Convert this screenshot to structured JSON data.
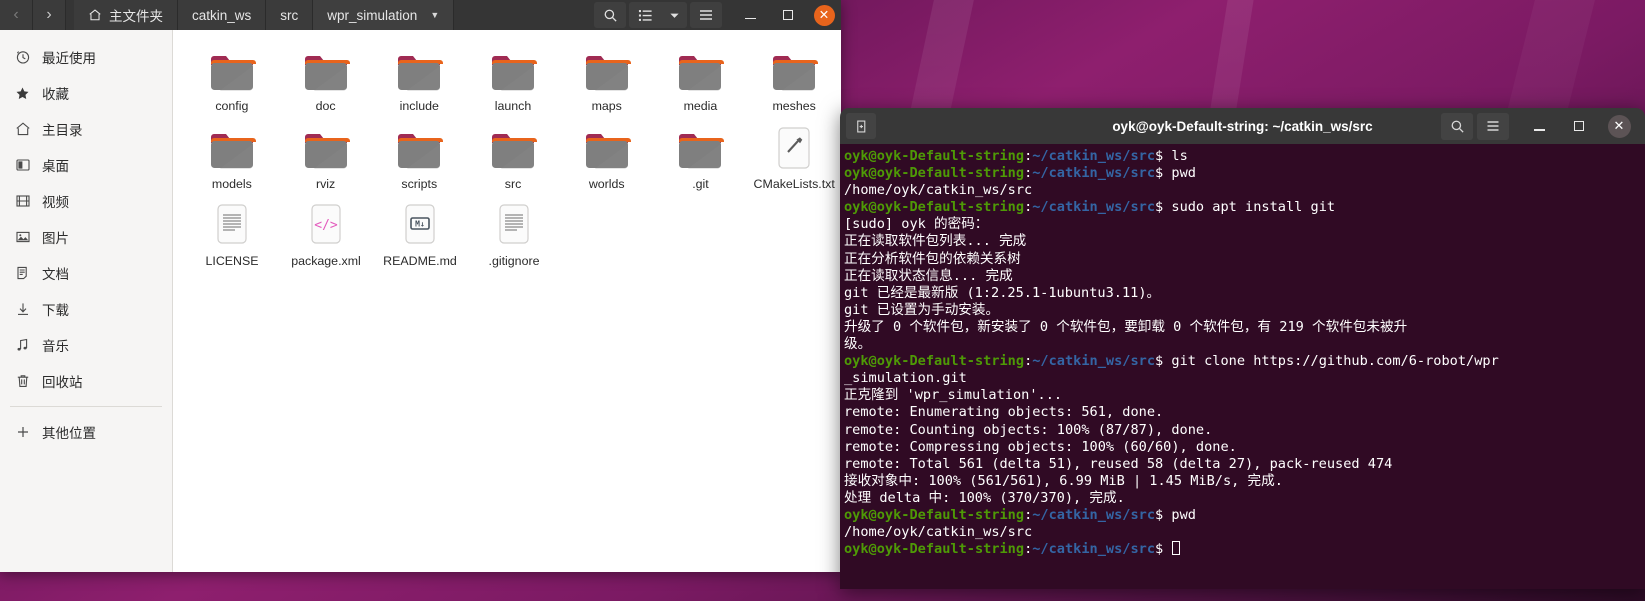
{
  "file_manager": {
    "nav": {
      "back": "‹",
      "forward": "›"
    },
    "breadcrumbs": [
      {
        "label": "主文件夹",
        "icon": "home-icon",
        "active": false
      },
      {
        "label": "catkin_ws",
        "icon": "",
        "active": false
      },
      {
        "label": "src",
        "icon": "",
        "active": false
      },
      {
        "label": "wpr_simulation",
        "icon": "",
        "active": true
      }
    ],
    "toolbar": {
      "search": "search-icon",
      "view_list": "list-view-icon",
      "view_dropdown": "chevron-down-icon",
      "menu": "hamburger-menu-icon"
    },
    "window_controls": {
      "minimize": "–",
      "maximize": "□",
      "close": "✕"
    },
    "sidebar": [
      {
        "label": "最近使用",
        "icon": "clock-icon"
      },
      {
        "label": "收藏",
        "icon": "star-icon"
      },
      {
        "label": "主目录",
        "icon": "home-icon"
      },
      {
        "label": "桌面",
        "icon": "desktop-icon"
      },
      {
        "label": "视频",
        "icon": "video-icon"
      },
      {
        "label": "图片",
        "icon": "image-icon"
      },
      {
        "label": "文档",
        "icon": "document-icon"
      },
      {
        "label": "下载",
        "icon": "download-icon"
      },
      {
        "label": "音乐",
        "icon": "music-icon"
      },
      {
        "label": "回收站",
        "icon": "trash-icon"
      },
      {
        "label": "其他位置",
        "icon": "plus-icon",
        "separated": true
      }
    ],
    "files": [
      [
        {
          "name": "config",
          "type": "folder"
        },
        {
          "name": "doc",
          "type": "folder"
        },
        {
          "name": "include",
          "type": "folder"
        },
        {
          "name": "launch",
          "type": "folder"
        },
        {
          "name": "maps",
          "type": "folder"
        },
        {
          "name": "media",
          "type": "folder"
        },
        {
          "name": "meshes",
          "type": "folder"
        }
      ],
      [
        {
          "name": "models",
          "type": "folder"
        },
        {
          "name": "rviz",
          "type": "folder"
        },
        {
          "name": "scripts",
          "type": "folder"
        },
        {
          "name": "src",
          "type": "folder"
        },
        {
          "name": "worlds",
          "type": "folder"
        },
        {
          "name": ".git",
          "type": "folder"
        },
        {
          "name": "CMakeLists.txt",
          "type": "build-file"
        }
      ],
      [
        {
          "name": "LICENSE",
          "type": "text-file"
        },
        {
          "name": "package.xml",
          "type": "code-file"
        },
        {
          "name": "README.md",
          "type": "markdown-file"
        },
        {
          "name": ".gitignore",
          "type": "text-file"
        }
      ]
    ]
  },
  "terminal": {
    "title": "oyk@oyk-Default-string: ~/catkin_ws/src",
    "new_tab_icon": "new-tab-icon",
    "search_icon": "search-icon",
    "menu_icon": "hamburger-menu-icon",
    "window_controls": {
      "minimize": "–",
      "maximize": "□",
      "close": "✕"
    },
    "prompt_user": "oyk@oyk-Default-string",
    "prompt_path": "~/catkin_ws/src",
    "lines": [
      {
        "type": "prompt",
        "command": " ls"
      },
      {
        "type": "prompt",
        "command": " pwd"
      },
      {
        "type": "out",
        "text": "/home/oyk/catkin_ws/src"
      },
      {
        "type": "prompt",
        "command": " sudo apt install git"
      },
      {
        "type": "out",
        "text": "[sudo] oyk 的密码："
      },
      {
        "type": "out",
        "text": "正在读取软件包列表... 完成"
      },
      {
        "type": "out",
        "text": "正在分析软件包的依赖关系树"
      },
      {
        "type": "out",
        "text": "正在读取状态信息... 完成"
      },
      {
        "type": "out",
        "text": "git 已经是最新版 (1:2.25.1-1ubuntu3.11)。"
      },
      {
        "type": "out",
        "text": "git 已设置为手动安装。"
      },
      {
        "type": "out",
        "text": "升级了 0 个软件包，新安装了 0 个软件包，要卸载 0 个软件包，有 219 个软件包未被升"
      },
      {
        "type": "out",
        "text": "级。"
      },
      {
        "type": "prompt",
        "command": " git clone https://github.com/6-robot/wpr"
      },
      {
        "type": "out",
        "text": "_simulation.git"
      },
      {
        "type": "out",
        "text": "正克隆到 'wpr_simulation'..."
      },
      {
        "type": "out",
        "text": "remote: Enumerating objects: 561, done."
      },
      {
        "type": "out",
        "text": "remote: Counting objects: 100% (87/87), done."
      },
      {
        "type": "out",
        "text": "remote: Compressing objects: 100% (60/60), done."
      },
      {
        "type": "out",
        "text": "remote: Total 561 (delta 51), reused 58 (delta 27), pack-reused 474"
      },
      {
        "type": "out",
        "text": "接收对象中: 100% (561/561), 6.99 MiB | 1.45 MiB/s, 完成."
      },
      {
        "type": "out",
        "text": "处理 delta 中: 100% (370/370), 完成."
      },
      {
        "type": "prompt",
        "command": " pwd"
      },
      {
        "type": "out",
        "text": "/home/oyk/catkin_ws/src"
      },
      {
        "type": "prompt",
        "command": " ",
        "cursor": true
      }
    ]
  },
  "colors": {
    "terminal_bg": "#300a24",
    "prompt_user": "#4e9a06",
    "prompt_path": "#3465a4",
    "close_accent": "#e8641c",
    "headerbar": "#353535"
  }
}
